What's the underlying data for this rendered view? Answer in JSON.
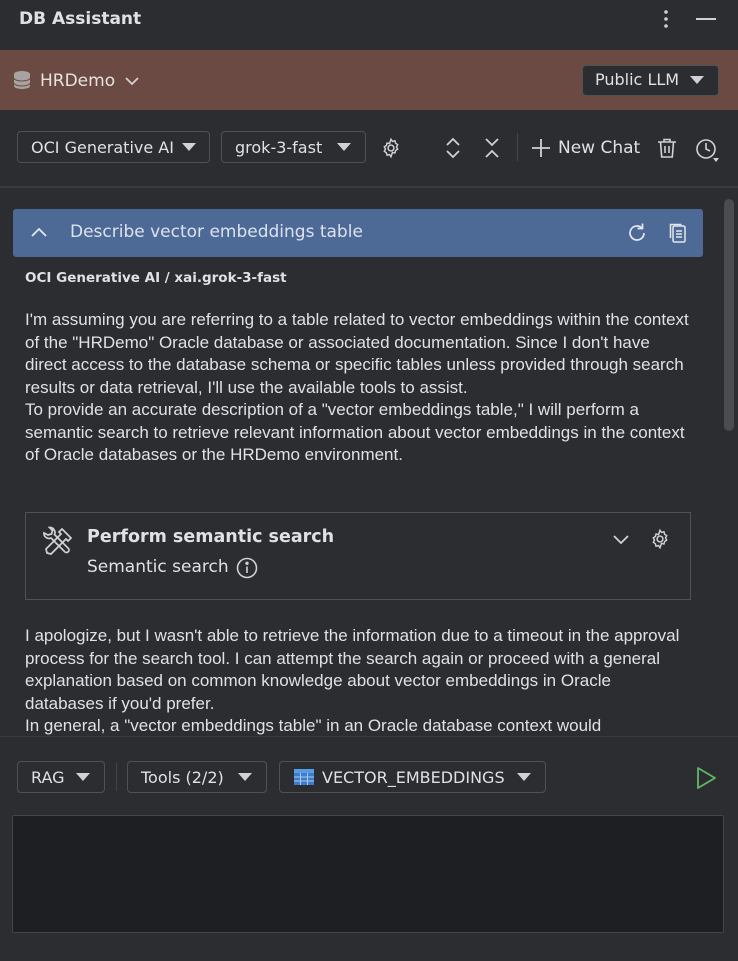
{
  "window": {
    "title": "DB Assistant"
  },
  "connection": {
    "name": "HRDemo",
    "llm_mode": "Public LLM"
  },
  "toolbar": {
    "provider": "OCI Generative AI",
    "model": "grok-3-fast",
    "new_chat_label": "New Chat"
  },
  "chat": {
    "question": "Describe vector embeddings table",
    "source": "OCI Generative AI / xai.grok-3-fast",
    "response_part1": [
      "I'm assuming you are referring to a table related to vector embeddings within the context of the \"HRDemo\" Oracle database or associated documentation. Since I don't have direct access to the database schema or specific tables unless provided through search results or data retrieval, I'll use the available tools to assist.",
      "To provide an accurate description of a \"vector embeddings table,\" I will perform a semantic search to retrieve relevant information about vector embeddings in the context of Oracle databases or the HRDemo environment."
    ],
    "tool_call": {
      "title": "Perform semantic search",
      "subtitle": "Semantic search"
    },
    "response_part2": [
      "I apologize, but I wasn't able to retrieve the information due to a timeout in the approval process for the search tool. I can attempt the search again or proceed with a general explanation based on common knowledge about vector embeddings in Oracle databases if you'd prefer.",
      "In general, a \"vector embeddings table\" in an Oracle database context would"
    ]
  },
  "input_bar": {
    "rag_label": "RAG",
    "tools_label": "Tools (2/2)",
    "table_label": "VECTOR_EMBEDDINGS",
    "prompt_value": ""
  },
  "colors": {
    "background": "#2b2d30",
    "connection_bar": "#6b4a44",
    "question_header": "#4d6a96",
    "send_icon": "#5fb865"
  },
  "icons": {
    "more": "more-vertical-icon",
    "minimize": "minimize-icon",
    "database": "database-icon",
    "settings": "gear-icon",
    "expand": "expand-all-icon",
    "collapse": "collapse-all-icon",
    "new_chat": "plus-icon",
    "delete": "trash-icon",
    "history": "history-clock-icon",
    "refresh": "refresh-icon",
    "copy": "copy-icon",
    "tool": "tools-icon",
    "info": "info-icon",
    "table": "table-icon",
    "send": "send-play-icon"
  }
}
